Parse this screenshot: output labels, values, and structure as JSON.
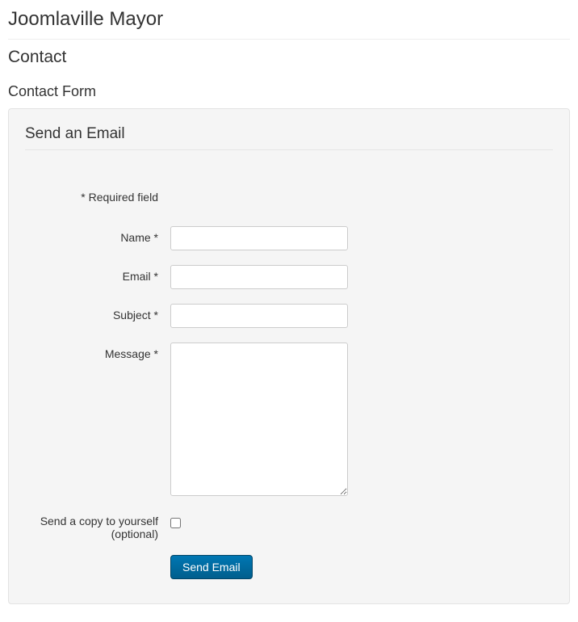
{
  "page_title": "Joomlaville Mayor",
  "section_title": "Contact",
  "subsection_title": "Contact Form",
  "form": {
    "legend": "Send an Email",
    "required_note": "* Required field",
    "fields": {
      "name": {
        "label": "Name *",
        "value": ""
      },
      "email": {
        "label": "Email *",
        "value": ""
      },
      "subject": {
        "label": "Subject *",
        "value": ""
      },
      "message": {
        "label": "Message *",
        "value": ""
      },
      "copy": {
        "label": "Send a copy to yourself (optional)"
      }
    },
    "submit_label": "Send Email"
  }
}
